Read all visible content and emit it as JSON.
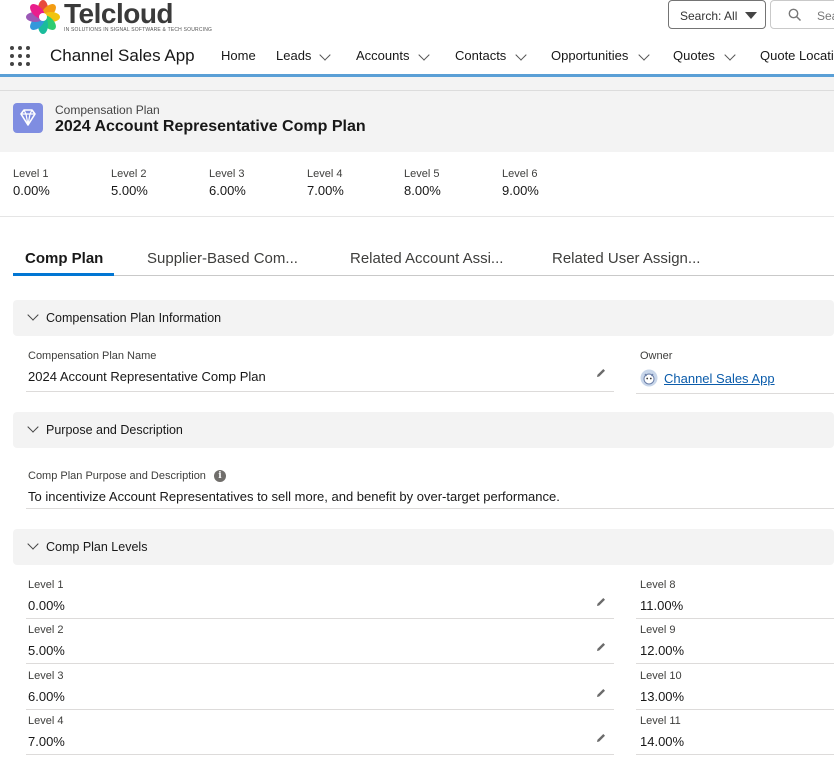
{
  "brand": {
    "name": "Telcloud",
    "tagline": "IN SOLUTIONS IN SIGNAL SOFTWARE & TECH SOURCING"
  },
  "search": {
    "scope": "Search: All",
    "placeholder": "Search..."
  },
  "nav": {
    "app_name": "Channel Sales App",
    "items": [
      {
        "label": "Home"
      },
      {
        "label": "Leads"
      },
      {
        "label": "Accounts"
      },
      {
        "label": "Contacts"
      },
      {
        "label": "Opportunities"
      },
      {
        "label": "Quotes"
      },
      {
        "label": "Quote Locations"
      }
    ]
  },
  "record": {
    "object_label": "Compensation Plan",
    "title": "2024 Account Representative Comp Plan",
    "highlights": [
      {
        "label": "Level 1",
        "value": "0.00%"
      },
      {
        "label": "Level 2",
        "value": "5.00%"
      },
      {
        "label": "Level 3",
        "value": "6.00%"
      },
      {
        "label": "Level 4",
        "value": "7.00%"
      },
      {
        "label": "Level 5",
        "value": "8.00%"
      },
      {
        "label": "Level 6",
        "value": "9.00%"
      }
    ]
  },
  "tabs": [
    {
      "label": "Comp Plan"
    },
    {
      "label": "Supplier-Based Com..."
    },
    {
      "label": "Related Account Assi..."
    },
    {
      "label": "Related User Assign..."
    }
  ],
  "sections": {
    "info": {
      "title": "Compensation Plan Information",
      "name_label": "Compensation Plan Name",
      "name_value": "2024 Account Representative Comp Plan",
      "owner_label": "Owner",
      "owner_value": "Channel Sales App"
    },
    "purpose": {
      "title": "Purpose and Description",
      "label": "Comp Plan Purpose and Description",
      "value": "To incentivize Account Representatives to sell more, and benefit by over-target performance."
    },
    "levels": {
      "title": "Comp Plan Levels",
      "left": [
        {
          "label": "Level 1",
          "value": "0.00%"
        },
        {
          "label": "Level 2",
          "value": "5.00%"
        },
        {
          "label": "Level 3",
          "value": "6.00%"
        },
        {
          "label": "Level 4",
          "value": "7.00%"
        }
      ],
      "right": [
        {
          "label": "Level 8",
          "value": "11.00%"
        },
        {
          "label": "Level 9",
          "value": "12.00%"
        },
        {
          "label": "Level 10",
          "value": "13.00%"
        },
        {
          "label": "Level 11",
          "value": "14.00%"
        }
      ]
    }
  },
  "colors": {
    "accent": "#0176d3",
    "nav_line": "#5a9fd6",
    "plan_icon": "#7f8de1",
    "link": "#0b5cab"
  }
}
